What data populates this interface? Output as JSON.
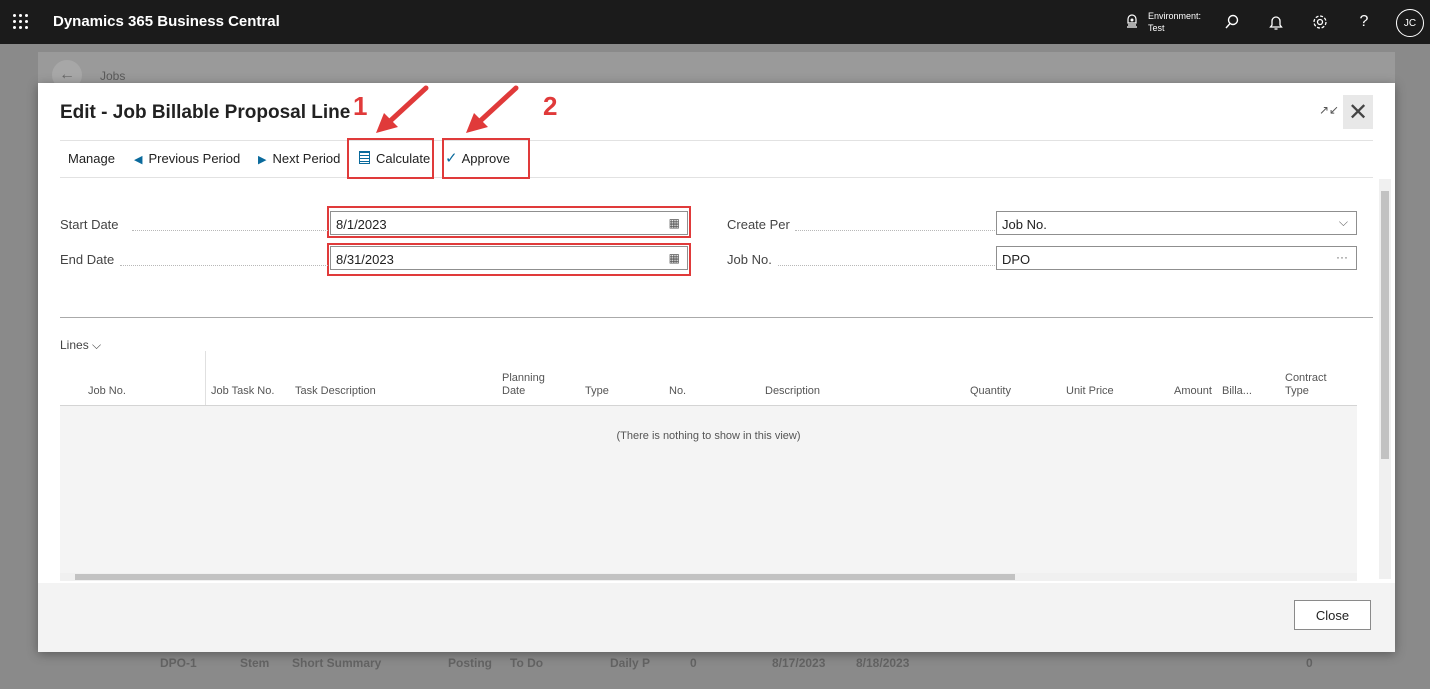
{
  "header": {
    "app_name": "Dynamics 365 Business Central",
    "environment_label": "Environment:",
    "environment_value": "Test",
    "user_initials": "JC",
    "help_glyph": "?",
    "icons": [
      "waffle-icon",
      "environment-icon",
      "search-icon",
      "bell-icon",
      "settings-icon",
      "help-icon"
    ]
  },
  "background": {
    "breadcrumb": "Jobs",
    "row": [
      "DPO-1",
      "Stem",
      "Short Summary",
      "Posting",
      "To Do",
      "Daily P",
      "0",
      "8/17/2023",
      "8/18/2023",
      "0"
    ]
  },
  "dialog": {
    "title": "Edit - Job Billable Proposal Line",
    "actions": {
      "manage": "Manage",
      "previous_period": "Previous Period",
      "next_period": "Next Period",
      "calculate": "Calculate",
      "approve": "Approve"
    },
    "annotations": {
      "callout_1": "1",
      "callout_2": "2",
      "color": "#e03a3a"
    },
    "fields": {
      "start_date_label": "Start Date",
      "start_date_value": "8/1/2023",
      "end_date_label": "End Date",
      "end_date_value": "8/31/2023",
      "create_per_label": "Create Per",
      "create_per_value": "Job No.",
      "job_no_label": "Job No.",
      "job_no_value": "DPO"
    },
    "lines": {
      "caption": "Lines",
      "columns": {
        "job_no": "Job No.",
        "job_task_no": "Job Task No.",
        "task_description": "Task Description",
        "planning_date_1": "Planning",
        "planning_date_2": "Date",
        "type": "Type",
        "no": "No.",
        "description": "Description",
        "quantity": "Quantity",
        "unit_price": "Unit Price",
        "amount": "Amount",
        "billable": "Billa...",
        "contract_type_1": "Contract",
        "contract_type_2": "Type"
      },
      "empty_message": "(There is nothing to show in this view)",
      "rows": []
    },
    "close_label": "Close"
  },
  "colors": {
    "topbar": "#1b1b1b",
    "accent": "#0a6a9c",
    "highlight": "#e03a3a"
  }
}
